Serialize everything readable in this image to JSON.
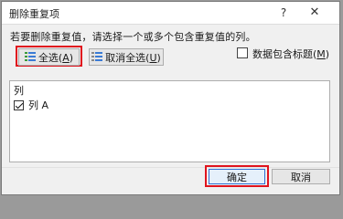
{
  "window": {
    "title": "删除重复项",
    "help_glyph": "?",
    "close_glyph": "✕"
  },
  "instruction": "若要删除重复值，请选择一个或多个包含重复值的列。",
  "buttons": {
    "select_all": {
      "label": "全选(",
      "key": "A",
      "suffix": ")"
    },
    "deselect_all": {
      "label": "取消全选(",
      "key": "U",
      "suffix": ")"
    },
    "ok": "确定",
    "cancel": "取消"
  },
  "header_checkbox": {
    "label": "数据包含标题(",
    "key": "M",
    "suffix": ")",
    "checked": false
  },
  "columns_list": {
    "header": "列",
    "items": [
      {
        "label": "列 A",
        "checked": true
      }
    ]
  },
  "colors": {
    "highlight": "#e0141e",
    "icon_blue": "#3a7bd5",
    "icon_green": "#3a9a3a"
  },
  "icons": [
    "list-check-icon",
    "list-uncheck-icon",
    "checkmark-icon",
    "help-icon",
    "close-icon"
  ]
}
